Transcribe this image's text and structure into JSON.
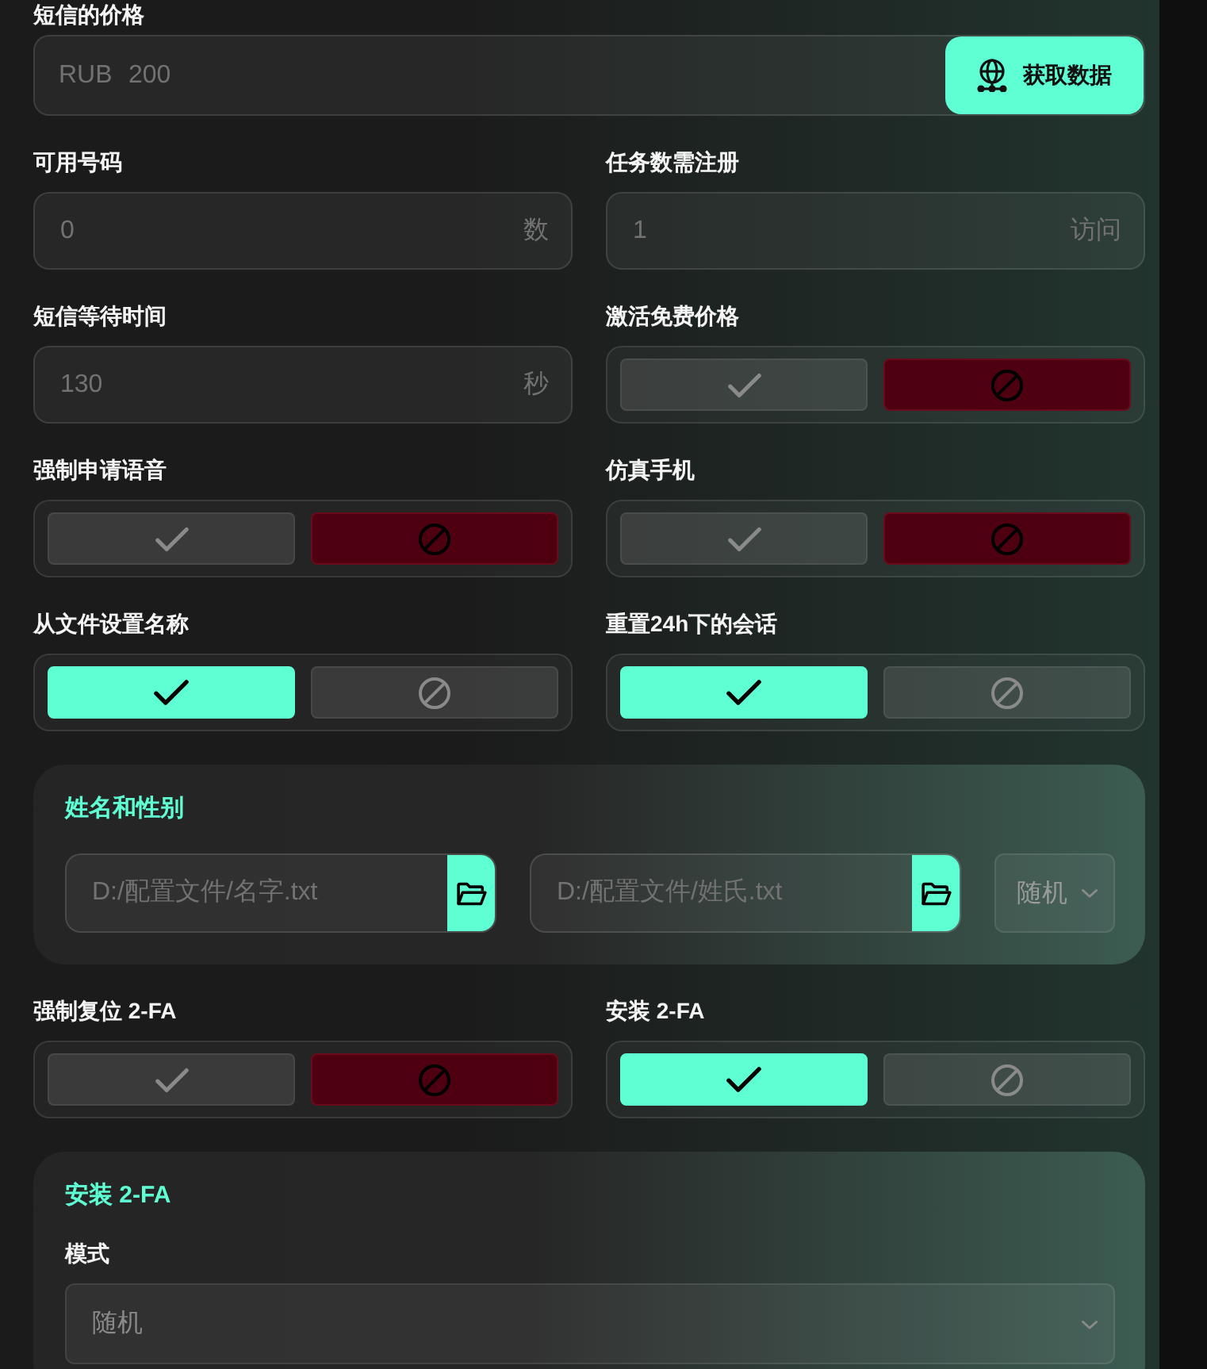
{
  "price": {
    "label": "短信的价格",
    "currency": "RUB",
    "placeholder": "200",
    "button": "获取数据"
  },
  "fields": [
    {
      "kind": "input",
      "label": "可用号码",
      "placeholder": "0",
      "unit": "数"
    },
    {
      "kind": "input",
      "label": "任务数需注册",
      "placeholder": "1",
      "unit": "访问"
    },
    {
      "kind": "input",
      "label": "短信等待时间",
      "placeholder": "130",
      "unit": "秒"
    },
    {
      "kind": "toggle",
      "label": "激活免费价格",
      "on": false
    },
    {
      "kind": "toggle",
      "label": "强制申请语音",
      "on": false
    },
    {
      "kind": "toggle",
      "label": "仿真手机",
      "on": false
    },
    {
      "kind": "toggle",
      "label": "从文件设置名称",
      "on": true
    },
    {
      "kind": "toggle",
      "label": "重置24h下的会话",
      "on": true
    }
  ],
  "name_section": {
    "title": "姓名和性别",
    "files": [
      {
        "placeholder": "D:/配置文件/名字.txt"
      },
      {
        "placeholder": "D:/配置文件/姓氏.txt"
      }
    ],
    "gender_select": "随机"
  },
  "fields_2": [
    {
      "kind": "toggle",
      "label": "强制复位 2-FA",
      "on": false
    },
    {
      "kind": "toggle",
      "label": "安装 2-FA",
      "on": true
    }
  ],
  "twofa_section": {
    "title": "安装 2-FA",
    "mode_label": "模式",
    "mode_select": "随机"
  }
}
